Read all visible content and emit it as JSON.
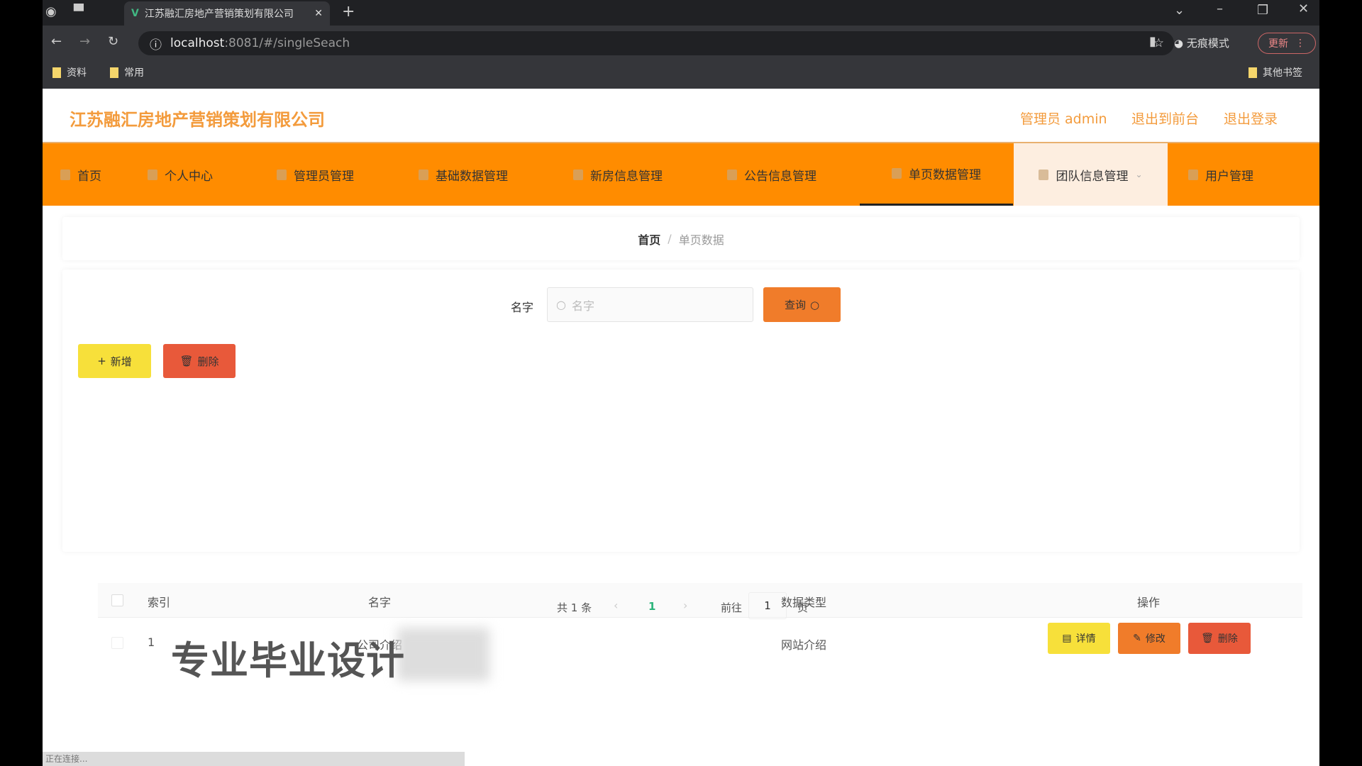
{
  "browser": {
    "tab_title": "江苏融汇房地产营销策划有限公司",
    "url_host": "localhost",
    "url_rest": ":8081/#/singleSeach",
    "incognito_label": "无痕模式",
    "update_label": "更新",
    "bookmarks": [
      "资料",
      "常用"
    ],
    "other_bookmarks": "其他书签"
  },
  "header": {
    "title": "江苏融汇房地产营销策划有限公司",
    "admin": "管理员 admin",
    "to_front": "退出到前台",
    "logout": "退出登录"
  },
  "nav": [
    "首页",
    "个人中心",
    "管理员管理",
    "基础数据管理",
    "新房信息管理",
    "公告信息管理",
    "单页数据管理",
    "团队信息管理",
    "用户管理"
  ],
  "breadcrumb": {
    "home": "首页",
    "sep": "/",
    "current": "单页数据"
  },
  "search": {
    "label": "名字",
    "placeholder": "名字",
    "button": "查询"
  },
  "actions": {
    "add": "新增",
    "delete": "删除"
  },
  "table": {
    "headers": [
      "索引",
      "名字",
      "数据类型",
      "操作"
    ],
    "rows": [
      {
        "index": "1",
        "name": "公司介绍",
        "type": "网站介绍",
        "detail": "详情",
        "edit": "修改",
        "delete": "删除"
      }
    ]
  },
  "pagination": {
    "total": "共 1 条",
    "current": "1",
    "goto": "前往",
    "page_input": "1",
    "page_suffix": "页"
  },
  "watermark": "专业毕业设计",
  "status": "正在连接...",
  "colors": {
    "nav": "#ff8c00",
    "accent": "#f39b3c",
    "query": "#f07c2a",
    "add": "#f7e03a",
    "delete": "#e8593a"
  }
}
